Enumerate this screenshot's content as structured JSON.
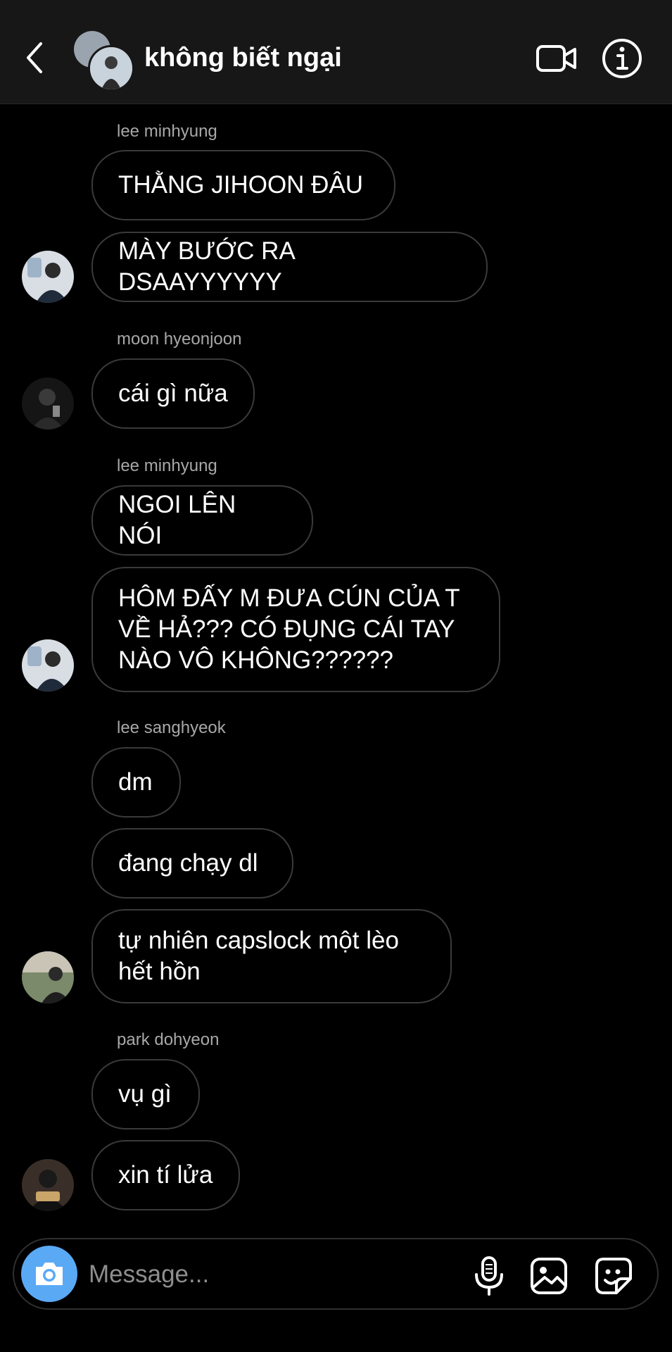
{
  "header": {
    "back_icon": "chevron-left-icon",
    "title": "không biết ngại",
    "video_icon": "video-camera-icon",
    "info_icon": "info-icon"
  },
  "messages": [
    {
      "sender": "lee minhyung",
      "bubbles": [
        "THẰNG JIHOON ĐÂU",
        "MÀY BƯỚC RA DSAAYYYYYY"
      ]
    },
    {
      "sender": "moon hyeonjoon",
      "bubbles": [
        "cái gì nữa"
      ]
    },
    {
      "sender": "lee minhyung",
      "bubbles": [
        "NGOI LÊN NÓI",
        "HÔM ĐẤY M ĐƯA CÚN CỦA T\nVỀ HẢ??? CÓ ĐỤNG CÁI TAY\nNÀO VÔ KHÔNG??????"
      ]
    },
    {
      "sender": "lee sanghyeok",
      "bubbles": [
        "dm",
        "đang chạy dl",
        "tự nhiên capslock một lèo\nhết hồn"
      ]
    },
    {
      "sender": "park dohyeon",
      "bubbles": [
        "vụ gì",
        "xin tí lửa"
      ]
    }
  ],
  "composer": {
    "placeholder": "Message...",
    "icons": [
      "camera-icon",
      "microphone-icon",
      "image-icon",
      "sticker-icon"
    ]
  },
  "colors": {
    "background": "#000000",
    "header": "#171717",
    "bubble_border": "#3a3a3a",
    "camera_button": "#5aa9f5",
    "sender_text": "#a8a8a8"
  }
}
